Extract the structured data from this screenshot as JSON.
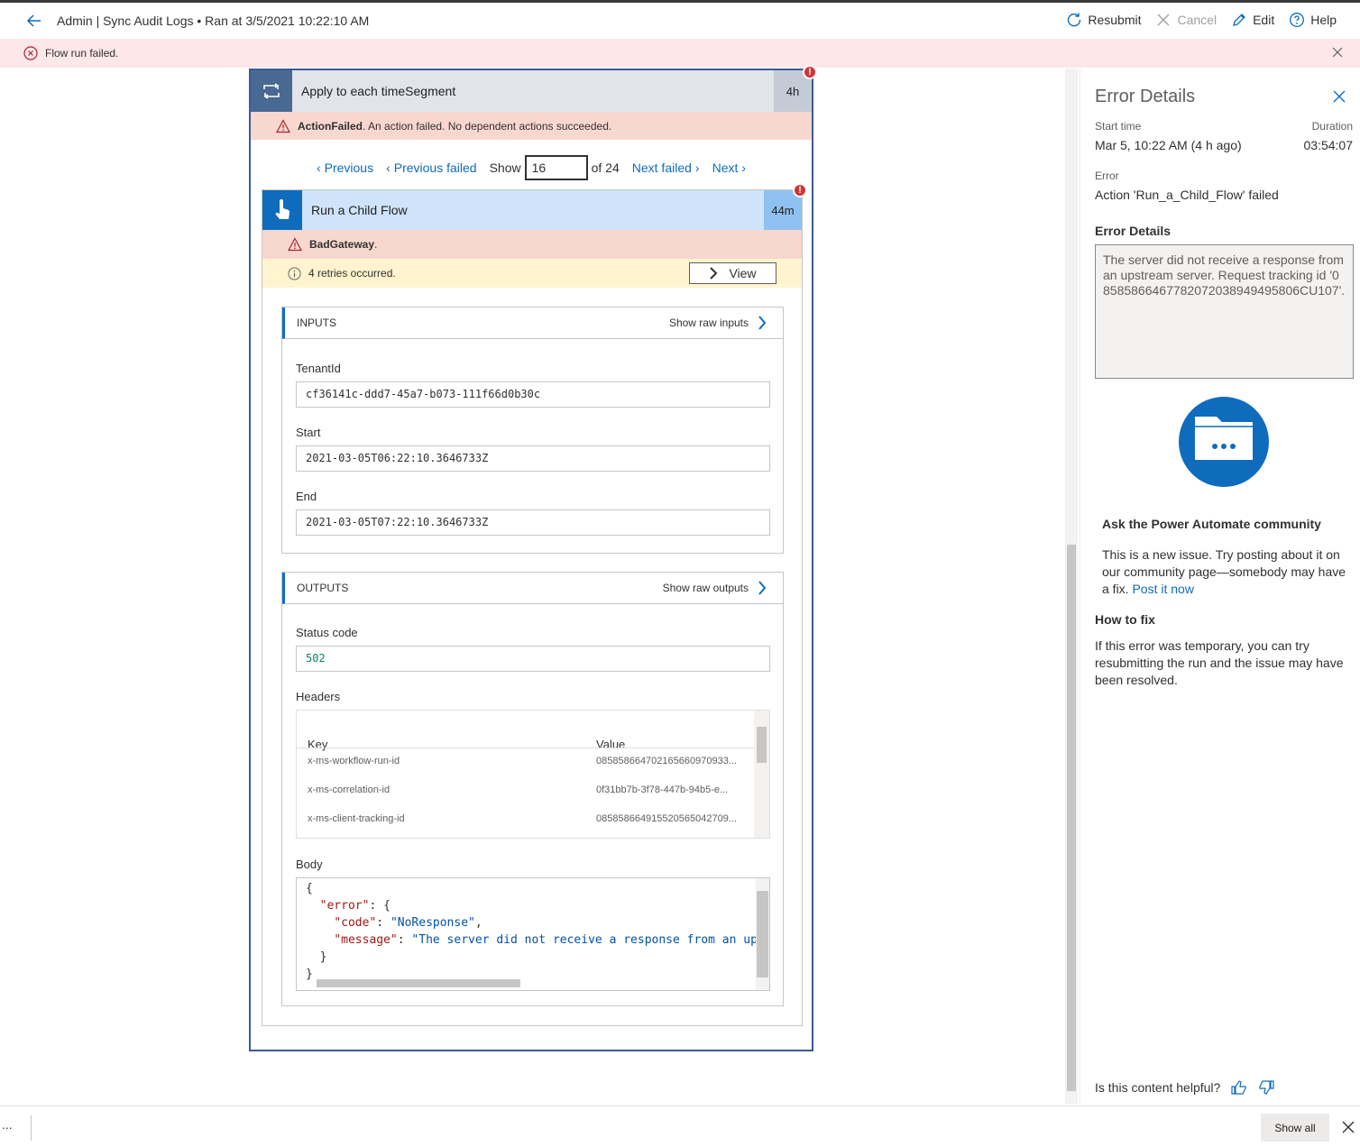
{
  "header": {
    "title": "Admin | Sync Audit Logs • Ran at 3/5/2021 10:22:10 AM",
    "commands": {
      "resubmit": "Resubmit",
      "cancel": "Cancel",
      "edit": "Edit",
      "help": "Help"
    }
  },
  "banner": {
    "message": "Flow run failed."
  },
  "loop": {
    "title": "Apply to each timeSegment",
    "duration": "4h",
    "error_code": "ActionFailed",
    "error_message": ". An action failed. No dependent actions succeeded."
  },
  "pager": {
    "previous": "Previous",
    "previous_failed": "Previous failed",
    "show_label": "Show",
    "current": "16",
    "of_total": "of 24",
    "next_failed": "Next failed",
    "next": "Next"
  },
  "child": {
    "title": "Run a Child Flow",
    "duration": "44m",
    "error_code": "BadGateway",
    "error_suffix": ".",
    "retries": "4 retries occurred.",
    "view_label": "View"
  },
  "inputs": {
    "header": "INPUTS",
    "raw_label": "Show raw inputs",
    "fields": [
      {
        "label": "TenantId",
        "value": "cf36141c-ddd7-45a7-b073-111f66d0b30c"
      },
      {
        "label": "Start",
        "value": "2021-03-05T06:22:10.3646733Z"
      },
      {
        "label": "End",
        "value": "2021-03-05T07:22:10.3646733Z"
      }
    ]
  },
  "outputs": {
    "header": "OUTPUTS",
    "raw_label": "Show raw outputs",
    "status_label": "Status code",
    "status_value": "502",
    "headers_label": "Headers",
    "headers_cols": {
      "key": "Key",
      "value": "Value"
    },
    "headers_rows": [
      {
        "key": "x-ms-workflow-run-id",
        "value": "085858664702165660970933..."
      },
      {
        "key": "x-ms-correlation-id",
        "value": "0f31bb7b-3f78-447b-94b5-e..."
      },
      {
        "key": "x-ms-client-tracking-id",
        "value": "085858664915520565042709..."
      }
    ],
    "body_label": "Body",
    "body_lines": {
      "l1": "{",
      "l2_key": "\"error\"",
      "l2_rest": ": {",
      "l3_key": "\"code\"",
      "l3_sep": ": ",
      "l3_val": "\"NoResponse\"",
      "l3_end": ",",
      "l4_key": "\"message\"",
      "l4_sep": ": ",
      "l4_val": "\"The server did not receive a response from an upstr",
      "l5": "}",
      "l6": "}"
    }
  },
  "error_panel": {
    "title": "Error Details",
    "start_time_label": "Start time",
    "start_time_value": "Mar 5, 10:22 AM (4 h ago)",
    "duration_label": "Duration",
    "duration_value": "03:54:07",
    "error_label": "Error",
    "error_value": "Action 'Run_a_Child_Flow' failed",
    "details_label": "Error Details",
    "details_text": "The server did not receive a response from an upstream server. Request tracking id '08585866467782072038949495806CU107'.",
    "community_title": "Ask the Power Automate community",
    "community_text": "This is a new issue. Try posting about it on our community page—somebody may have a fix.",
    "community_link": "Post it now",
    "fix_title": "How to fix",
    "fix_text": "If this error was temporary, you can try resubmitting the run and the issue may have been resolved.",
    "helpful_label": "Is this content helpful?"
  },
  "bottom": {
    "dots": "...",
    "show_all": "Show all"
  },
  "colors": {
    "accent": "#0f6cbd",
    "error_bg": "#fde7e9",
    "error_strip": "#f8d7cf",
    "warning_bg": "#fff4ce",
    "loop_header": "#486991"
  }
}
